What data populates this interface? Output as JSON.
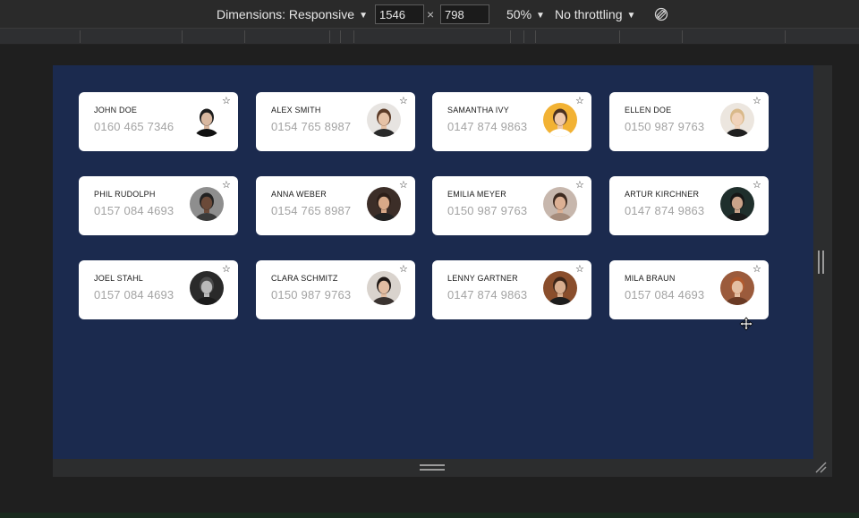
{
  "toolbar": {
    "dimensions_label": "Dimensions: Responsive",
    "width_value": "1546",
    "times_symbol": "×",
    "height_value": "798",
    "zoom_label": "50%",
    "throttling_label": "No throttling",
    "caret": "▼"
  },
  "contacts": [
    {
      "name": "JOHN DOE",
      "phone": "0160 465 7346",
      "avatar_bg": "#ffffff",
      "skin": "#d9b8a0",
      "hair": "#1d1d1d",
      "shirt": "#111111"
    },
    {
      "name": "ALEX SMITH",
      "phone": "0154 765 8987",
      "avatar_bg": "#e7e4e1",
      "skin": "#e6c2a6",
      "hair": "#5b3a26",
      "shirt": "#2a2a2a"
    },
    {
      "name": "SAMANTHA IVY",
      "phone": "0147 874 9863",
      "avatar_bg": "#f2b234",
      "skin": "#f0c9aa",
      "hair": "#4a3020",
      "shirt": "#ffffff"
    },
    {
      "name": "ELLEN DOE",
      "phone": "0150 987 9763",
      "avatar_bg": "#ece6df",
      "skin": "#f1d3bb",
      "hair": "#d9b98a",
      "shirt": "#1f1f1f"
    },
    {
      "name": "PHIL RUDOLPH",
      "phone": "0157 084 4693",
      "avatar_bg": "#8e8e8e",
      "skin": "#6b4a39",
      "hair": "#222222",
      "shirt": "#3a3a3a"
    },
    {
      "name": "ANNA WEBER",
      "phone": "0154 765 8987",
      "avatar_bg": "#3c2e28",
      "skin": "#d8a988",
      "hair": "#2c1e18",
      "shirt": "#222222"
    },
    {
      "name": "EMILIA MEYER",
      "phone": "0150 987 9763",
      "avatar_bg": "#c7b7ad",
      "skin": "#dcb094",
      "hair": "#3d2a20",
      "shirt": "#a68c7c"
    },
    {
      "name": "ARTUR KIRCHNER",
      "phone": "0147 874 9863",
      "avatar_bg": "#1f2f2c",
      "skin": "#c9a289",
      "hair": "#161616",
      "shirt": "#1a1a1a"
    },
    {
      "name": "JOEL STAHL",
      "phone": "0157 084 4693",
      "avatar_bg": "#2a2a2a",
      "skin": "#b9b9b9",
      "hair": "#4a4a4a",
      "shirt": "#1b1b1b"
    },
    {
      "name": "CLARA SCHMITZ",
      "phone": "0150 987 9763",
      "avatar_bg": "#d9d3cd",
      "skin": "#e2bda2",
      "hair": "#1e1815",
      "shirt": "#3a3330"
    },
    {
      "name": "LENNY GARTNER",
      "phone": "0147 874 9863",
      "avatar_bg": "#8a4e2c",
      "skin": "#d8ad8e",
      "hair": "#3c2518",
      "shirt": "#1d1d1d"
    },
    {
      "name": "MILA BRAUN",
      "phone": "0157 084 4693",
      "avatar_bg": "#9b5b3c",
      "skin": "#e4bfa2",
      "hair": "#b15a2e",
      "shirt": "#6a3a24"
    }
  ]
}
